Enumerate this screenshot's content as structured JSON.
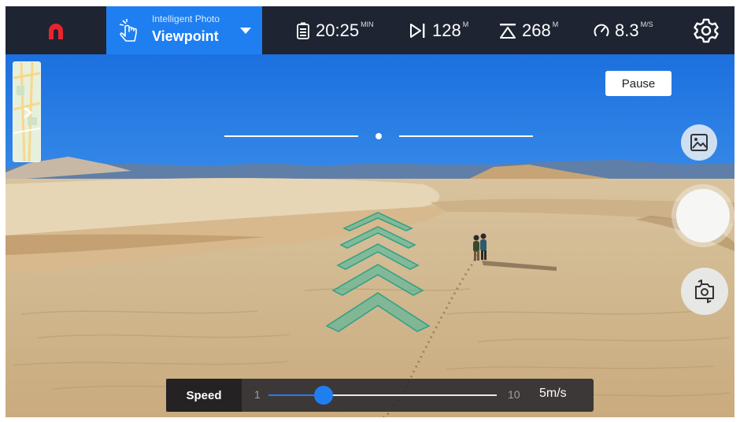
{
  "topbar": {
    "mode_small": "Intelligent Photo",
    "mode_big": "Viewpoint",
    "flight_time": "20:25",
    "flight_time_unit": "MIN",
    "distance": "128",
    "distance_unit": "M",
    "altitude": "268",
    "altitude_unit": "M",
    "speed": "8.3",
    "speed_unit": "M/S"
  },
  "pause_label": "Pause",
  "speed_control": {
    "label": "Speed",
    "min": "1",
    "max": "10",
    "current": "5m/s",
    "value_fraction": 0.24
  },
  "icons": [
    "brand-logo-icon",
    "hand-tap-icon",
    "battery-icon",
    "distance-icon",
    "altitude-icon",
    "speedometer-icon",
    "gear-icon",
    "gallery-icon",
    "switch-camera-icon"
  ],
  "colors": {
    "topbar_bg": "#1e2432",
    "mode_bg": "#1f7ff1",
    "accent": "#1f7ff1",
    "brand": "#e8252d",
    "chevron_fill": "#3fb89c"
  }
}
